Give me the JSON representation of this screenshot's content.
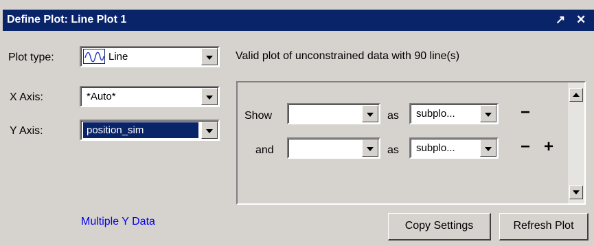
{
  "window": {
    "title": "Define Plot: Line Plot 1",
    "undock_glyph": "↗",
    "close_glyph": "✕"
  },
  "plot_type": {
    "label": "Plot type:",
    "value": "Line",
    "icon": "line-plot-icon"
  },
  "x_axis": {
    "label": "X Axis:",
    "value": "*Auto*"
  },
  "y_axis": {
    "label": "Y Axis:",
    "value": "position_sim"
  },
  "status": "Valid plot of unconstrained data with 90 line(s)",
  "rows": [
    {
      "prefix": "Show",
      "field_value": "",
      "as_label": "as",
      "mode_value": "subplo...",
      "remove": "−"
    },
    {
      "prefix": "and",
      "field_value": "",
      "as_label": "as",
      "mode_value": "subplo...",
      "remove": "−",
      "add": "+"
    }
  ],
  "multiple_y_link": "Multiple Y Data",
  "buttons": {
    "copy": "Copy Settings",
    "refresh": "Refresh Plot"
  },
  "colors": {
    "title_bg": "#0a246a",
    "window_bg": "#d6d3ce",
    "link": "#0000ee",
    "selection": "#0a246a"
  }
}
